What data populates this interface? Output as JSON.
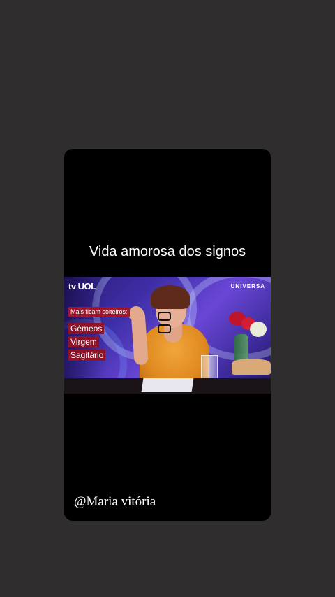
{
  "story": {
    "title": "Vida amorosa dos signos",
    "handle": "@Maria vitória"
  },
  "video": {
    "channel_logo": "tv UOL",
    "partner_logo": "UNIVERSA",
    "overlay_heading": "Mais ficam solteiros:",
    "signs": [
      "Gêmeos",
      "Virgem",
      "Sagitário"
    ]
  }
}
